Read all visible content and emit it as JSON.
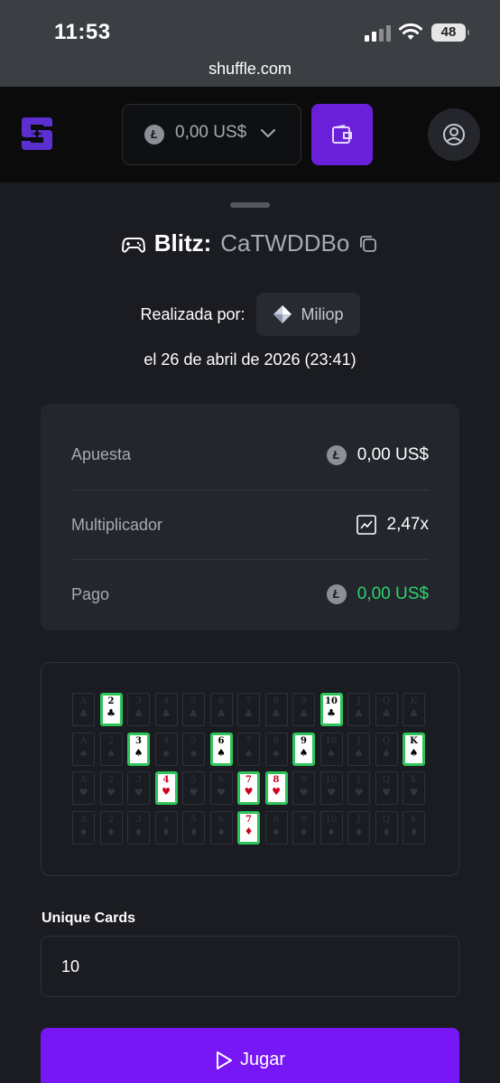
{
  "status_bar": {
    "time": "11:53",
    "battery": "48"
  },
  "browser": {
    "url": "shuffle.com"
  },
  "header": {
    "balance": "0,00 US$",
    "coin_symbol": "Ł",
    "brand_color": "#6a1fd9"
  },
  "bet": {
    "game": "Blitz:",
    "bet_id": "CaTWDDBo",
    "by_label": "Realizada por:",
    "username": "Miliop",
    "date": "el 26 de abril de 2026 (23:41)"
  },
  "stats": [
    {
      "label": "Apuesta",
      "value": "0,00 US$",
      "icon": "litecoin-icon"
    },
    {
      "label": "Multiplicador",
      "value": "2,47x",
      "icon": "chart-icon"
    },
    {
      "label": "Pago",
      "value": "0,00 US$",
      "icon": "litecoin-icon",
      "color": "#2dd46f"
    }
  ],
  "card_grid": {
    "ranks": [
      "A",
      "2",
      "3",
      "4",
      "5",
      "6",
      "7",
      "8",
      "9",
      "10",
      "J",
      "Q",
      "K"
    ],
    "suits": [
      "♣",
      "♠",
      "♥",
      "♦"
    ],
    "selected": [
      {
        "rank": "2",
        "suit": "♣"
      },
      {
        "rank": "10",
        "suit": "♣"
      },
      {
        "rank": "3",
        "suit": "♠"
      },
      {
        "rank": "6",
        "suit": "♠"
      },
      {
        "rank": "9",
        "suit": "♠"
      },
      {
        "rank": "K",
        "suit": "♠"
      },
      {
        "rank": "4",
        "suit": "♥"
      },
      {
        "rank": "7",
        "suit": "♥"
      },
      {
        "rank": "8",
        "suit": "♥"
      },
      {
        "rank": "7",
        "suit": "♦"
      }
    ],
    "highlight_color": "#2ec45a"
  },
  "form": {
    "label": "Unique Cards",
    "value": "10"
  },
  "play_button": {
    "label": "Jugar",
    "color": "#7717f5"
  }
}
